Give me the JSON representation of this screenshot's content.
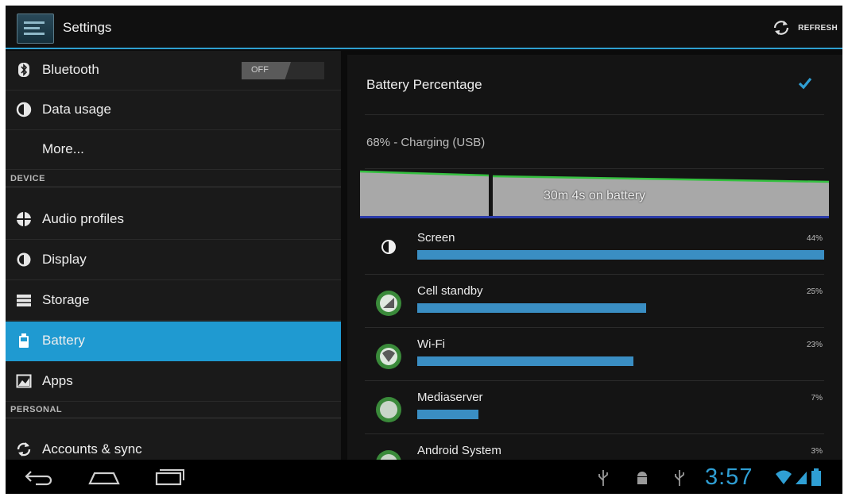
{
  "actionbar": {
    "title": "Settings",
    "refresh_label": "REFRESH"
  },
  "sidebar": {
    "items": [
      {
        "label": "Bluetooth",
        "icon": "bluetooth-icon",
        "toggle": "OFF"
      },
      {
        "label": "Data usage",
        "icon": "data-usage-icon"
      },
      {
        "label": "More..."
      },
      {
        "header": "DEVICE"
      },
      {
        "label": "Audio profiles",
        "icon": "audio-profiles-icon"
      },
      {
        "label": "Display",
        "icon": "display-icon"
      },
      {
        "label": "Storage",
        "icon": "storage-icon"
      },
      {
        "label": "Battery",
        "icon": "battery-icon",
        "selected": true
      },
      {
        "label": "Apps",
        "icon": "apps-icon"
      },
      {
        "header": "PERSONAL"
      },
      {
        "label": "Accounts & sync",
        "icon": "sync-icon"
      }
    ]
  },
  "battery": {
    "percentage_label": "Battery Percentage",
    "percentage_checked": true,
    "status": "68% - Charging (USB)",
    "graph_label": "30m 4s on battery",
    "apps": [
      {
        "name": "Screen",
        "percent_label": "44%",
        "usage": 0.44,
        "icon": "screen-brightness-icon"
      },
      {
        "name": "Cell standby",
        "percent_label": "25%",
        "usage": 0.25,
        "icon": "cell-standby-icon"
      },
      {
        "name": "Wi-Fi",
        "percent_label": "23%",
        "usage": 0.23,
        "icon": "wifi-icon"
      },
      {
        "name": "Mediaserver",
        "percent_label": "7%",
        "usage": 0.07,
        "icon": "android-mediaserver-icon"
      },
      {
        "name": "Android System",
        "percent_label": "3%",
        "usage": 0.03,
        "icon": "android-system-icon"
      }
    ]
  },
  "navbar": {
    "clock": "3:57"
  },
  "colors": {
    "accent": "#1f9ad1",
    "usage_bar": "#3a8ec3",
    "clock": "#2f9fd4"
  }
}
